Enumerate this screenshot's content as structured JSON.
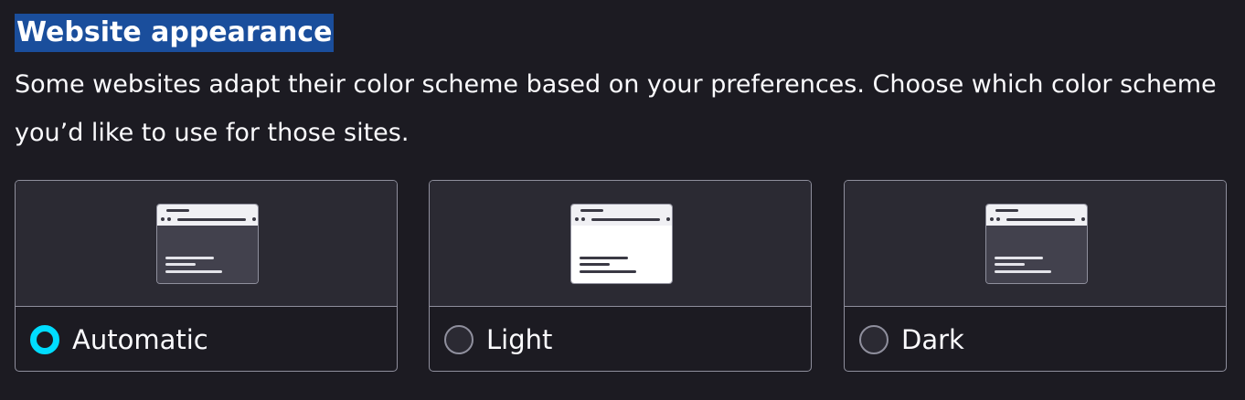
{
  "section": {
    "title": "Website appearance",
    "description": "Some websites adapt their color scheme based on your preferences. Choose which color scheme you’d like to use for those sites."
  },
  "options": [
    {
      "label": "Automatic",
      "selected": true,
      "preview_theme": "automatic"
    },
    {
      "label": "Light",
      "selected": false,
      "preview_theme": "light"
    },
    {
      "label": "Dark",
      "selected": false,
      "preview_theme": "dark"
    }
  ],
  "colors": {
    "background": "#1c1b22",
    "card_preview_bg": "#2b2a33",
    "border": "#8f8f9d",
    "accent": "#00ddff",
    "heading_highlight": "#1a4e9c",
    "text": "#fbfbfe"
  }
}
